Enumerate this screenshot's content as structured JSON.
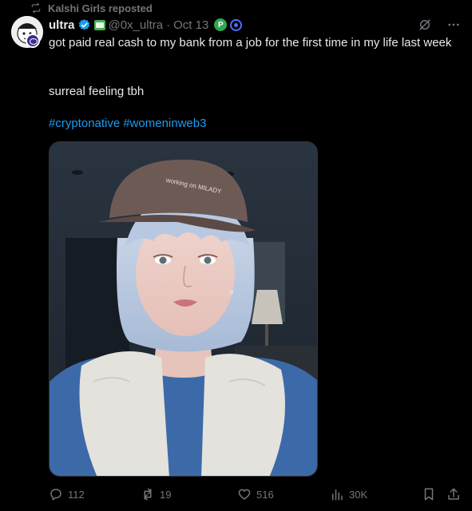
{
  "repost": {
    "label": "Kalshi Girls reposted"
  },
  "tweet": {
    "display_name": "ultra",
    "handle": "@0x_ultra",
    "separator": "·",
    "date": "Oct 13",
    "badge_p": "P",
    "body_line1": "got paid real cash to my bank from a job for the first time in my life last week",
    "body_line2": "surreal feeling tbh",
    "hashtags": [
      "#cryptonative",
      "#womeninweb3"
    ],
    "cap_text": "working on MILADY"
  },
  "actions": {
    "replies": "112",
    "reposts": "19",
    "likes": "516",
    "views": "30K"
  },
  "colors": {
    "background": "#000000",
    "text": "#e7e9ea",
    "muted": "#71767b",
    "link": "#1d9bf0",
    "verified": "#1d9bf0"
  }
}
